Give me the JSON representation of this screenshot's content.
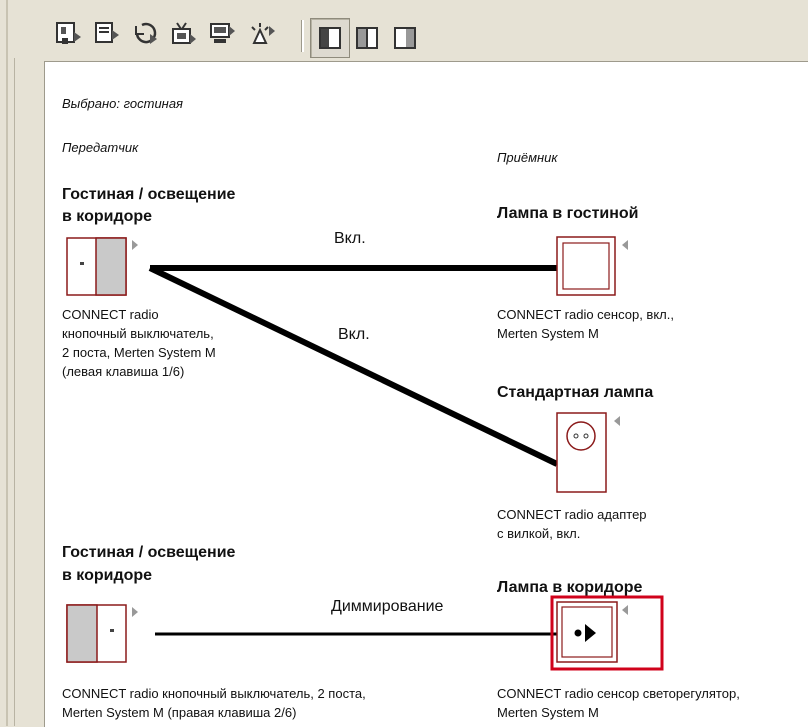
{
  "toolbar": {
    "buttons": [
      {
        "icon": "transmitter-add-icon"
      },
      {
        "icon": "receiver-add-icon"
      },
      {
        "icon": "undo-link-icon"
      },
      {
        "icon": "device-tv-icon"
      },
      {
        "icon": "monitor-icon"
      },
      {
        "icon": "alarm-icon"
      }
    ],
    "view_buttons": [
      {
        "icon": "view-left-pane-icon",
        "pressed": true
      },
      {
        "icon": "view-split-pane-icon",
        "pressed": false
      },
      {
        "icon": "view-right-pane-icon",
        "pressed": false
      }
    ]
  },
  "selection": "Выбрано: гостиная",
  "headers": {
    "transmitter": "Передатчик",
    "receiver": "Приёмник"
  },
  "transmitters": [
    {
      "title_line1": "Гостиная / освещение",
      "title_line2": "в коридоре",
      "description": "CONNECT radio\nкнопочный выключатель,\n2 поста, Merten System M\n(левая клавиша 1/6)"
    },
    {
      "title_line1": "Гостиная / освещение",
      "title_line2": "в коридоре",
      "description": "CONNECT radio кнопочный выключатель, 2 поста,\nMerten System M (правая клавиша 2/6)"
    }
  ],
  "receivers": [
    {
      "title": "Лампа в гостиной",
      "description": "CONNECT radio сенсор, вкл.,\nMerten System M"
    },
    {
      "title": "Стандартная лампа",
      "description": "CONNECT radio адаптер\nс вилкой, вкл."
    },
    {
      "title": "Лампа в коридоре",
      "description": "CONNECT radio сенсор светорегулятор,\nMerten System M",
      "selected": true
    }
  ],
  "links": [
    {
      "label": "Вкл."
    },
    {
      "label": "Вкл."
    },
    {
      "label": "Диммирование"
    }
  ],
  "colors": {
    "selection_frame": "#d0021b",
    "device_frame": "#8b1a1a",
    "device_fill": "#c9c9c9"
  }
}
